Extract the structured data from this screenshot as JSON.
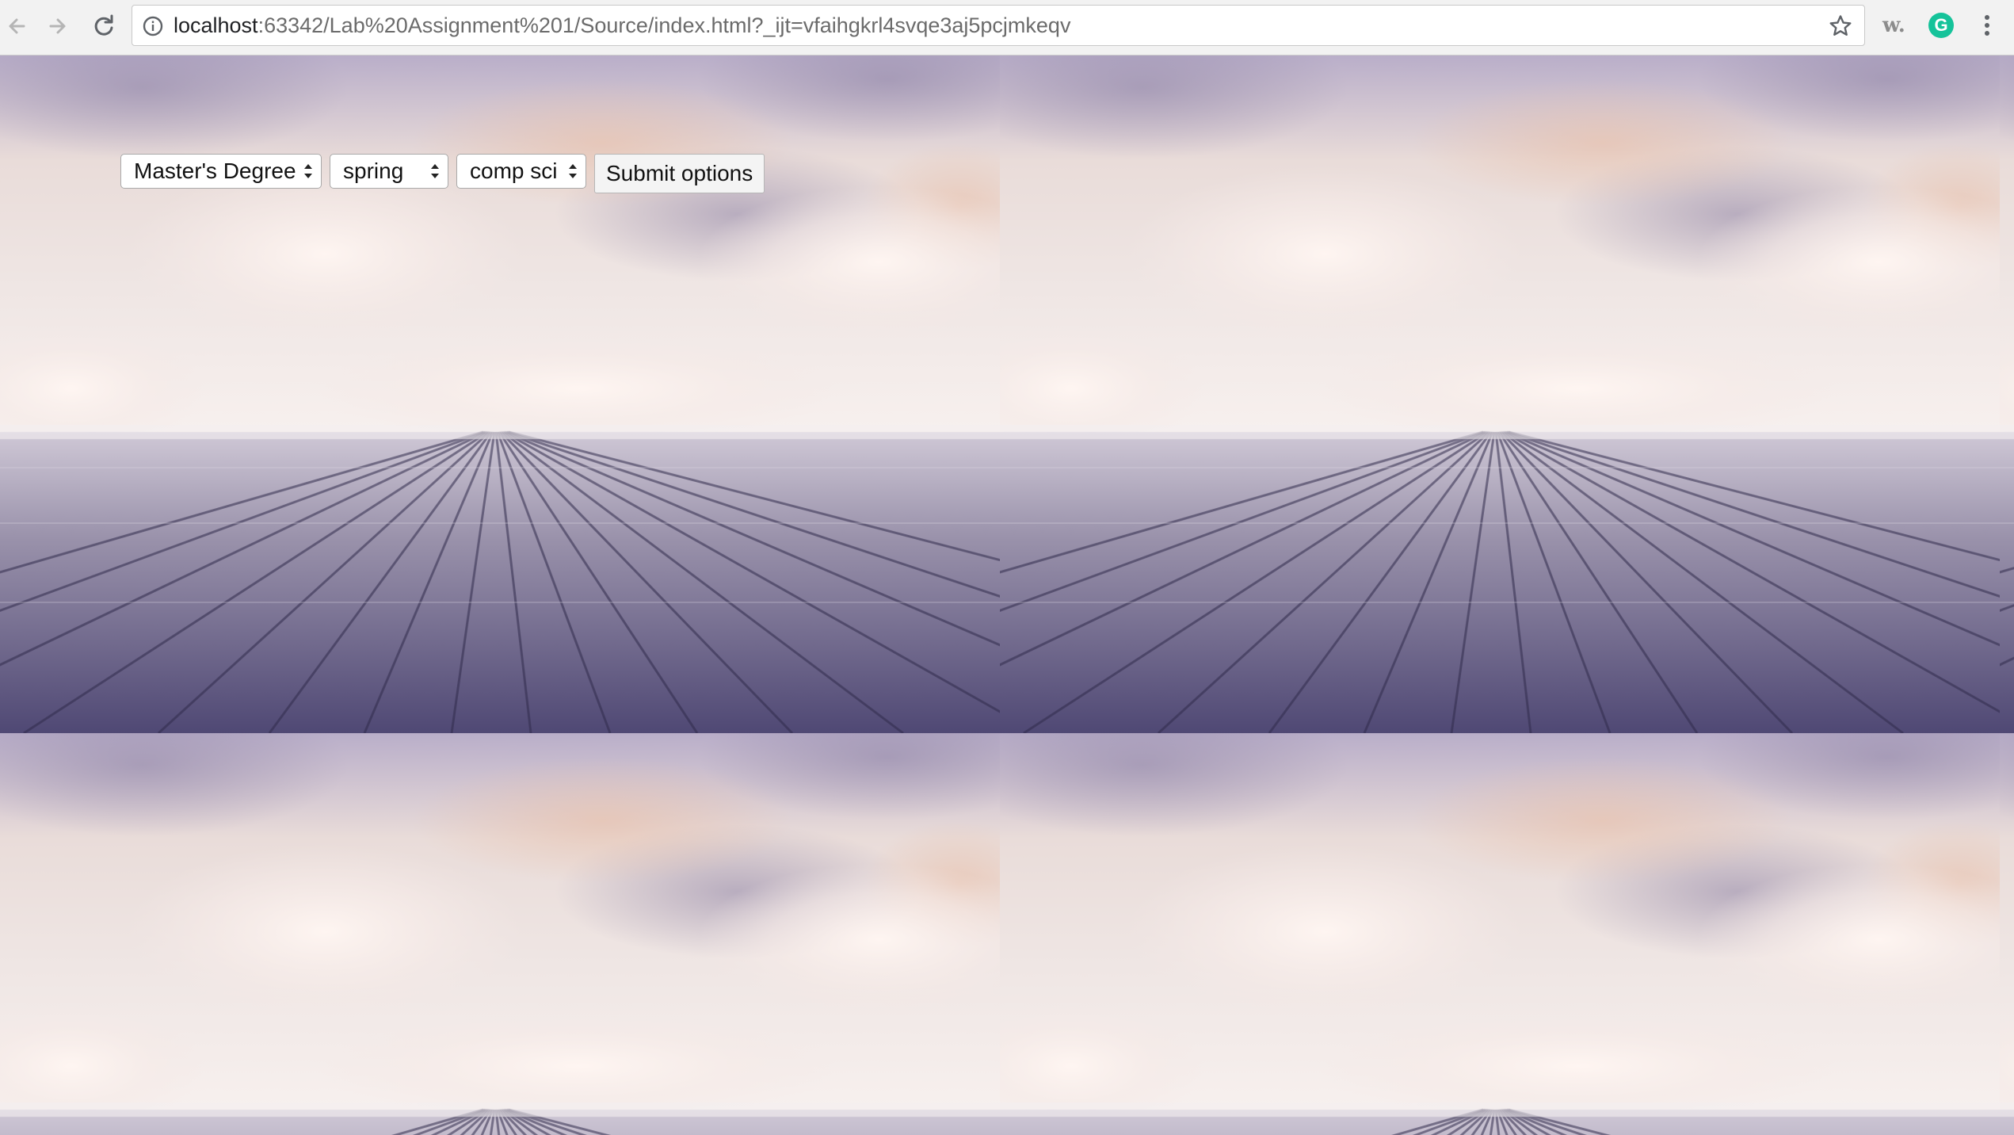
{
  "browser": {
    "url_host": "localhost",
    "url_rest": ":63342/Lab%20Assignment%201/Source/index.html?_ijt=vfaihgkrl4svqe3aj5pcjmkeqv",
    "icons": [
      "back-arrow-icon",
      "forward-arrow-icon",
      "reload-icon",
      "info-icon",
      "star-icon",
      "grammarly-icon",
      "menu-icon"
    ],
    "extension_w_label": "w.",
    "grammarly_label": "G"
  },
  "form": {
    "degree": {
      "selected": "Master's Degree"
    },
    "term": {
      "selected": "spring"
    },
    "major": {
      "selected": "comp sci"
    },
    "submit_label": "Submit options"
  },
  "colors": {
    "sky_top": "#b9aec9",
    "sky_mid": "#efe4e2",
    "deck_near": "#4f4874",
    "deck_far": "#c9c2d3",
    "grammarly": "#15c39a"
  }
}
